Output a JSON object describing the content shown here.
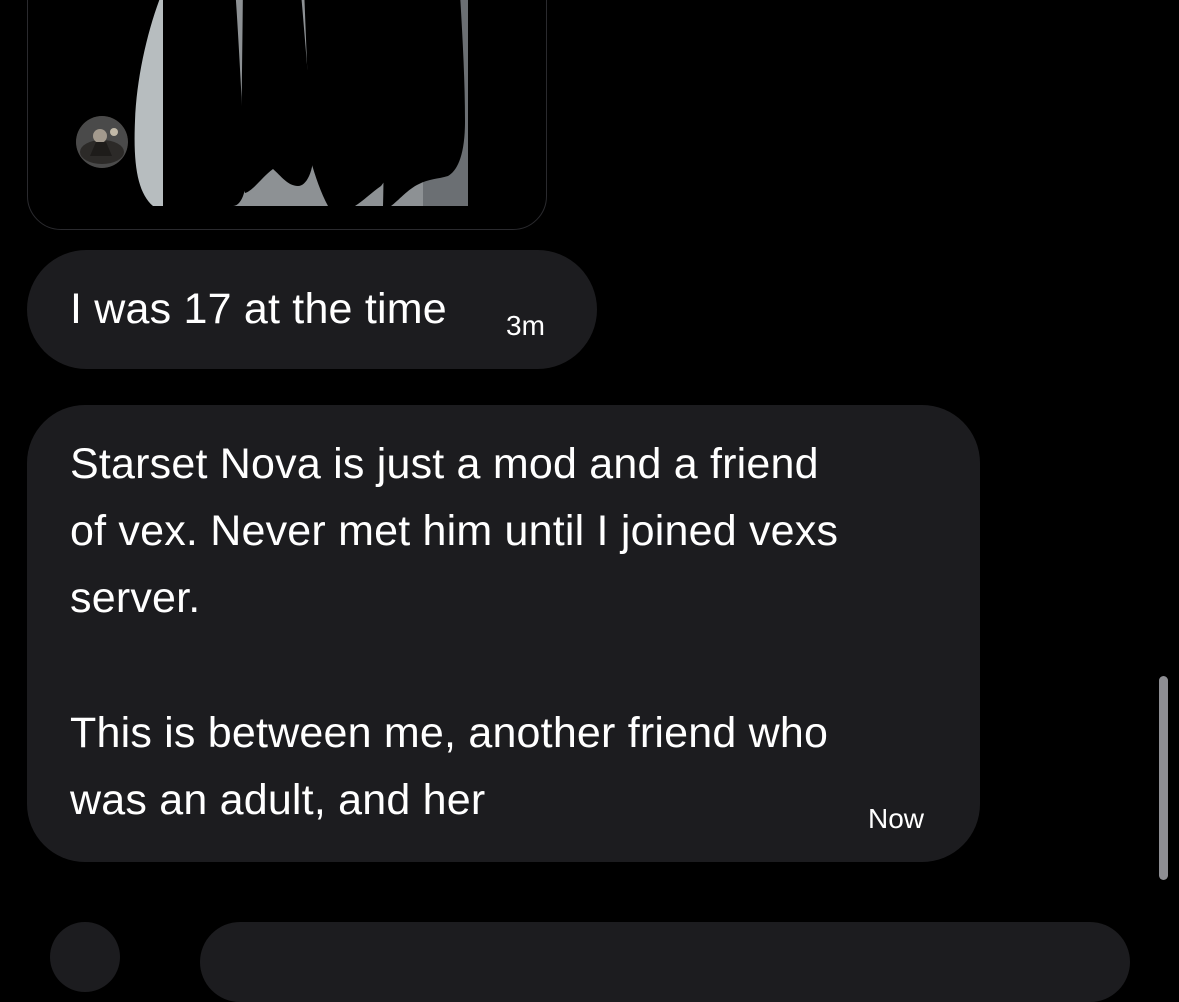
{
  "messages": [
    {
      "type": "media",
      "avatar_icon": "avatar-image"
    },
    {
      "type": "text",
      "text": "I was 17 at the time",
      "time": "3m"
    },
    {
      "type": "text",
      "line1": "Starset Nova is just a mod and a friend",
      "line2": "of vex. Never met him until I joined vexs",
      "line3": "server.",
      "line4": "This is between me, another friend who",
      "line5": "was an adult, and her",
      "time": "Now"
    }
  ],
  "colors": {
    "background": "#000000",
    "bubble": "#1c1c1f",
    "text": "#ffffff",
    "scrollbar": "#8e8e93"
  }
}
